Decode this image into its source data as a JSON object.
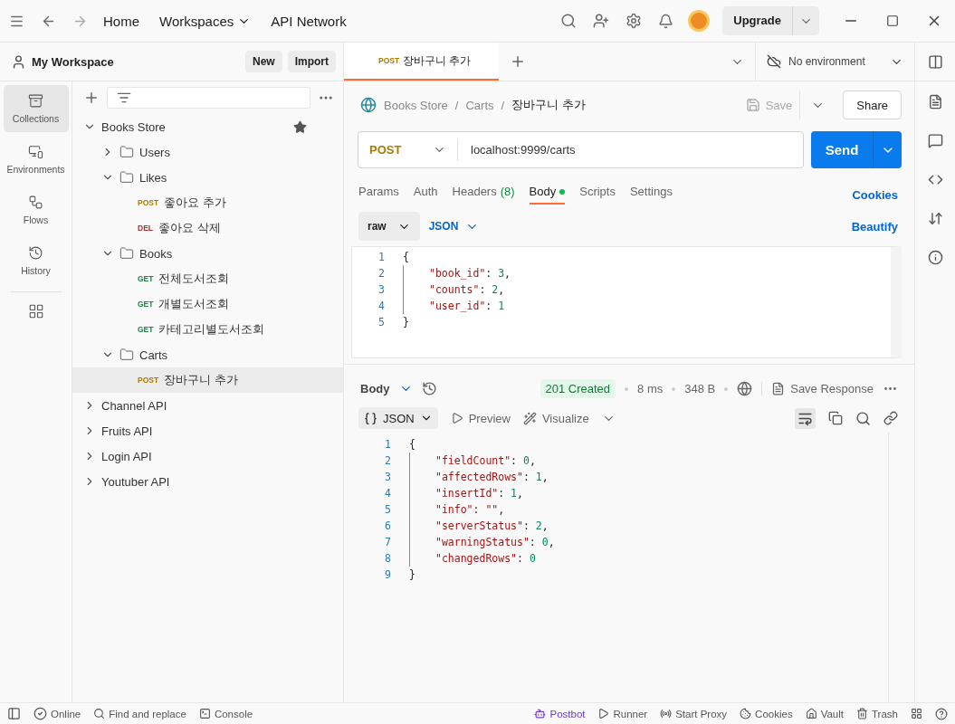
{
  "titlebar": {
    "nav": [
      {
        "label": "Home",
        "dropdown": false
      },
      {
        "label": "Workspaces",
        "dropdown": true
      },
      {
        "label": "API Network",
        "dropdown": false
      }
    ],
    "upgrade": "Upgrade"
  },
  "workspace": {
    "name": "My Workspace",
    "buttons": [
      "New",
      "Import"
    ]
  },
  "sidebar": {
    "items": [
      {
        "label": "Collections",
        "selected": true
      },
      {
        "label": "Environments",
        "selected": false
      },
      {
        "label": "Flows",
        "selected": false
      },
      {
        "label": "History",
        "selected": false
      }
    ]
  },
  "tree": [
    {
      "kind": "collection",
      "label": "Books Store",
      "expanded": true,
      "starred": true,
      "children": [
        {
          "kind": "folder",
          "label": "Users",
          "expanded": false
        },
        {
          "kind": "folder",
          "label": "Likes",
          "expanded": true,
          "children": [
            {
              "kind": "request",
              "method": "POST",
              "label": "좋아요 추가",
              "selected": false
            },
            {
              "kind": "request",
              "method": "DEL",
              "label": "좋아요 삭제",
              "selected": false
            }
          ]
        },
        {
          "kind": "folder",
          "label": "Books",
          "expanded": true,
          "children": [
            {
              "kind": "request",
              "method": "GET",
              "label": "전체도서조회",
              "selected": false
            },
            {
              "kind": "request",
              "method": "GET",
              "label": "개별도서조회",
              "selected": false
            },
            {
              "kind": "request",
              "method": "GET",
              "label": "카테고리별도서조회",
              "selected": false
            }
          ]
        },
        {
          "kind": "folder",
          "label": "Carts",
          "expanded": true,
          "children": [
            {
              "kind": "request",
              "method": "POST",
              "label": "장바구니 추가",
              "selected": true
            }
          ]
        }
      ]
    },
    {
      "kind": "collection",
      "label": "Channel API",
      "expanded": false,
      "starred": false
    },
    {
      "kind": "collection",
      "label": "Fruits API",
      "expanded": false,
      "starred": false
    },
    {
      "kind": "collection",
      "label": "Login API",
      "expanded": false,
      "starred": false
    },
    {
      "kind": "collection",
      "label": "Youtuber API",
      "expanded": false,
      "starred": false
    }
  ],
  "tabs": [
    {
      "method": "POST",
      "label": "장바구니 추가",
      "selected": true
    }
  ],
  "environment": "No environment",
  "breadcrumb": [
    {
      "label": "Books Store",
      "separator": "/"
    },
    {
      "label": "Carts",
      "separator": "/"
    }
  ],
  "title": "장바구니 추가",
  "save": "Save",
  "share": "Share",
  "request": {
    "method": "POST",
    "url": "localhost:9999/carts",
    "send": "Send"
  },
  "request_tabs": [
    {
      "label": "Params",
      "selected": false
    },
    {
      "label": "Auth",
      "selected": false
    },
    {
      "label": "Headers",
      "count": "(8)",
      "selected": false
    },
    {
      "label": "Body",
      "modified": true,
      "selected": true
    },
    {
      "label": "Scripts",
      "selected": false
    },
    {
      "label": "Settings",
      "selected": false
    }
  ],
  "cookies": "Cookies",
  "body_mode": "raw",
  "body_format": "JSON",
  "beautify": "Beautify",
  "request_body": [
    {
      "number": "1",
      "indent": false,
      "parts": [
        {
          "kind": "punct",
          "text": "{"
        }
      ]
    },
    {
      "number": "2",
      "indent": true,
      "parts": [
        {
          "kind": "key",
          "text": "\"book_id\""
        },
        {
          "kind": "punct",
          "text": ": "
        },
        {
          "kind": "number",
          "text": "3"
        },
        {
          "kind": "punct",
          "text": ","
        }
      ]
    },
    {
      "number": "3",
      "indent": true,
      "parts": [
        {
          "kind": "key",
          "text": "\"counts\""
        },
        {
          "kind": "punct",
          "text": ": "
        },
        {
          "kind": "number",
          "text": "2"
        },
        {
          "kind": "punct",
          "text": ","
        }
      ]
    },
    {
      "number": "4",
      "indent": true,
      "parts": [
        {
          "kind": "key",
          "text": "\"user_id\""
        },
        {
          "kind": "punct",
          "text": ": "
        },
        {
          "kind": "number",
          "text": "1"
        }
      ]
    },
    {
      "number": "5",
      "indent": false,
      "parts": [
        {
          "kind": "punct",
          "text": "}"
        }
      ]
    }
  ],
  "response": {
    "view": "Body",
    "status": "201 Created",
    "time": "8 ms",
    "size": "348 B",
    "save": "Save Response",
    "format": "JSON",
    "preview": "Preview",
    "visualize": "Visualize",
    "lines": [
      {
        "number": "1",
        "indent": false,
        "parts": [
          {
            "kind": "punct",
            "text": "{"
          }
        ]
      },
      {
        "number": "2",
        "indent": true,
        "parts": [
          {
            "kind": "key",
            "text": "\"fieldCount\""
          },
          {
            "kind": "punct",
            "text": ": "
          },
          {
            "kind": "number",
            "text": "0"
          },
          {
            "kind": "punct",
            "text": ","
          }
        ]
      },
      {
        "number": "3",
        "indent": true,
        "parts": [
          {
            "kind": "key",
            "text": "\"affectedRows\""
          },
          {
            "kind": "punct",
            "text": ": "
          },
          {
            "kind": "number",
            "text": "1"
          },
          {
            "kind": "punct",
            "text": ","
          }
        ]
      },
      {
        "number": "4",
        "indent": true,
        "parts": [
          {
            "kind": "key",
            "text": "\"insertId\""
          },
          {
            "kind": "punct",
            "text": ": "
          },
          {
            "kind": "number",
            "text": "1"
          },
          {
            "kind": "punct",
            "text": ","
          }
        ]
      },
      {
        "number": "5",
        "indent": true,
        "parts": [
          {
            "kind": "key",
            "text": "\"info\""
          },
          {
            "kind": "punct",
            "text": ": "
          },
          {
            "kind": "key",
            "text": "\"\""
          },
          {
            "kind": "punct",
            "text": ","
          }
        ]
      },
      {
        "number": "6",
        "indent": true,
        "parts": [
          {
            "kind": "key",
            "text": "\"serverStatus\""
          },
          {
            "kind": "punct",
            "text": ": "
          },
          {
            "kind": "number",
            "text": "2"
          },
          {
            "kind": "punct",
            "text": ","
          }
        ]
      },
      {
        "number": "7",
        "indent": true,
        "parts": [
          {
            "kind": "key",
            "text": "\"warningStatus\""
          },
          {
            "kind": "punct",
            "text": ": "
          },
          {
            "kind": "number",
            "text": "0"
          },
          {
            "kind": "punct",
            "text": ","
          }
        ]
      },
      {
        "number": "8",
        "indent": true,
        "parts": [
          {
            "kind": "key",
            "text": "\"changedRows\""
          },
          {
            "kind": "punct",
            "text": ": "
          },
          {
            "kind": "number",
            "text": "0"
          }
        ]
      },
      {
        "number": "9",
        "indent": false,
        "parts": [
          {
            "kind": "punct",
            "text": "}"
          }
        ]
      }
    ]
  },
  "status_bar": {
    "left": [
      "Online",
      "Find and replace",
      "Console"
    ],
    "right": [
      "Postbot",
      "Runner",
      "Start Proxy",
      "Cookies",
      "Vault",
      "Trash"
    ]
  }
}
